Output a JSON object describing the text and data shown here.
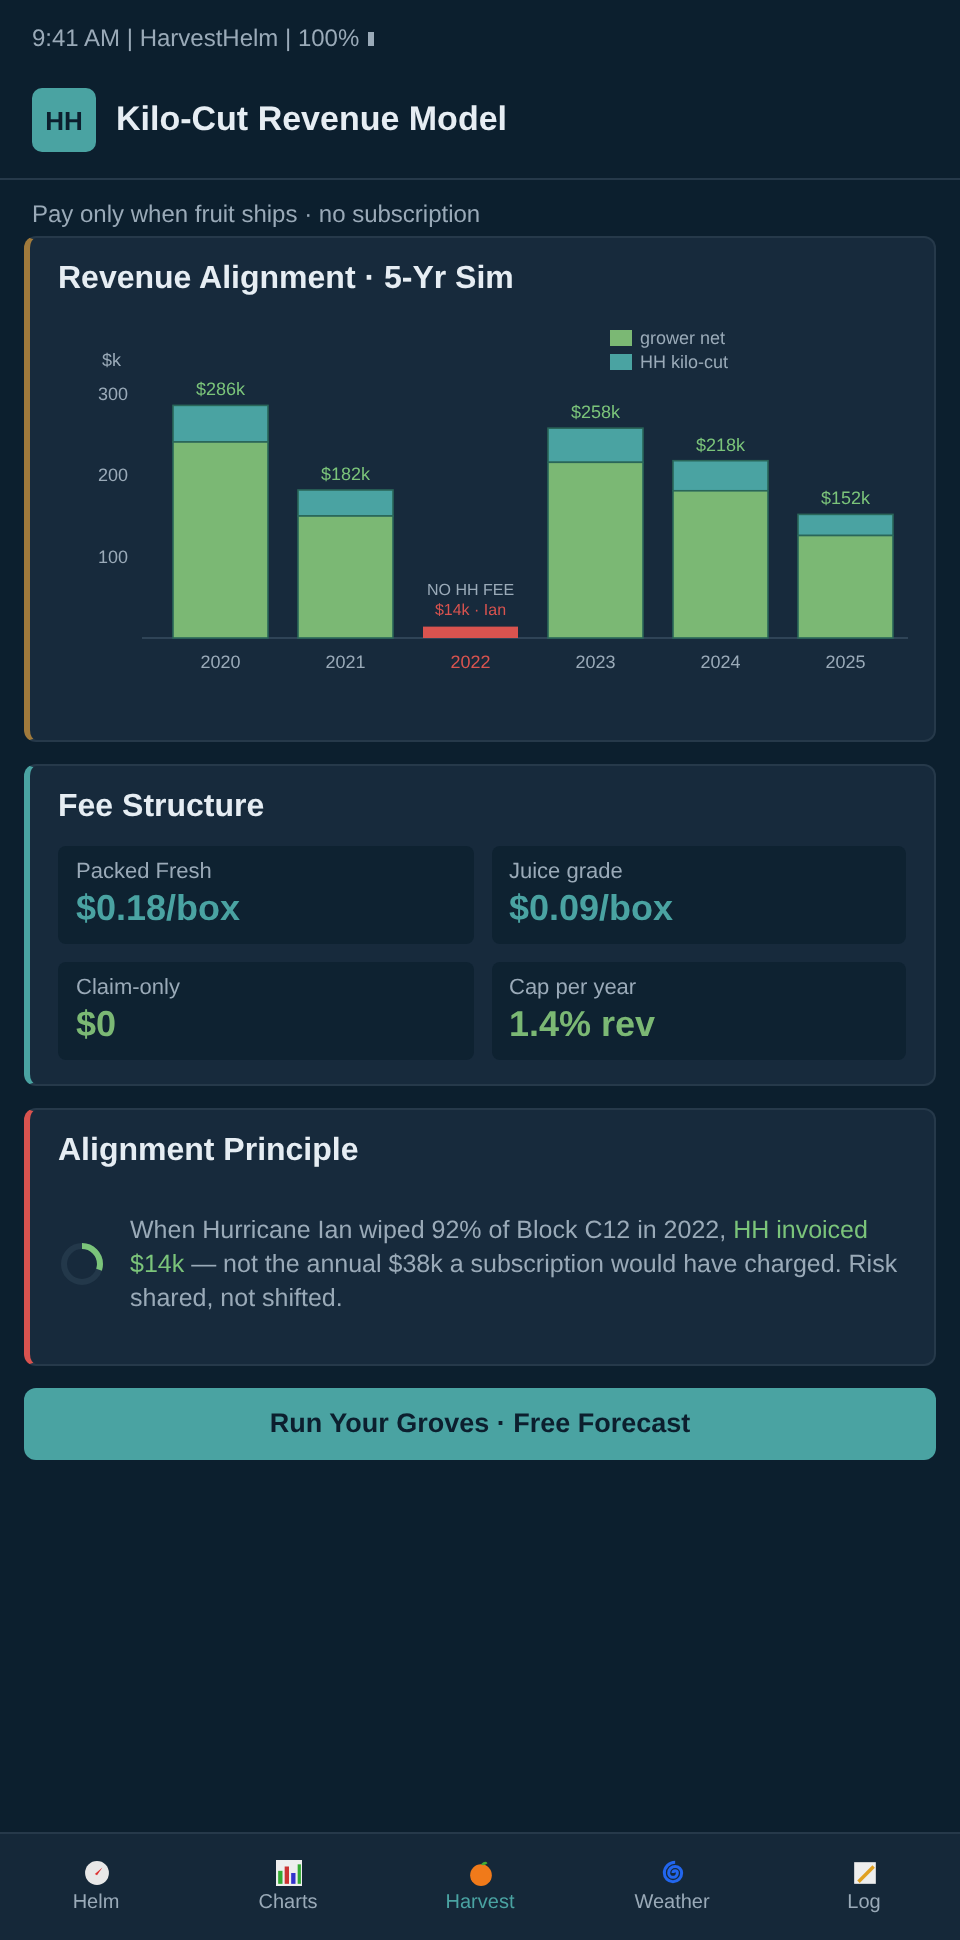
{
  "status_bar": {
    "text": "9:41 AM | HarvestHelm | 100%"
  },
  "header": {
    "logo": "HH",
    "title": "Kilo-Cut Revenue Model"
  },
  "subtitle": "Pay only when fruit ships · no subscription",
  "revenue_card": {
    "title": "Revenue Alignment · 5-Yr Sim",
    "color": "#a07a3c",
    "chart_data": {
      "type": "bar",
      "stacked": true,
      "ylabel": "$k",
      "ylim": [
        0,
        300
      ],
      "yticks": [
        100,
        200,
        300
      ],
      "categories": [
        "2020",
        "2021",
        "2022",
        "2023",
        "2024",
        "2025"
      ],
      "series": [
        {
          "name": "grower net",
          "color": "#7bb874",
          "values": [
            241,
            150,
            null,
            216,
            181,
            126
          ]
        },
        {
          "name": "HH kilo-cut",
          "color": "#4aa3a2",
          "values": [
            45,
            32,
            null,
            42,
            37,
            26
          ]
        },
        {
          "name": "$14k · Ian",
          "color": "#d9534f",
          "values": [
            null,
            null,
            14,
            null,
            null,
            null
          ]
        }
      ],
      "legend": "top-right",
      "value_labels": [
        "$286k",
        "$182k",
        null,
        "$258k",
        "$218k",
        "$152k"
      ],
      "annotations": [
        "NO HH FEE"
      ]
    }
  },
  "fee_card": {
    "title": "Fee Structure",
    "color": "#4aa3a2",
    "tiles": [
      {
        "label": "Packed Fresh",
        "value": "$0.18/box",
        "color": "#4aa3a2"
      },
      {
        "label": "Juice grade",
        "value": "$0.09/box",
        "color": "#4aa3a2"
      },
      {
        "label": "Claim-only",
        "value": "$0",
        "color": "#7bb874"
      },
      {
        "label": "Cap per year",
        "value": "1.4% rev",
        "color": "#7bb874"
      }
    ]
  },
  "principle_card": {
    "title": "Alignment Principle",
    "color": "#d9534f",
    "text": "When Hurricane Ian wiped 92% of Block C12 in 2022, **HH invoiced $14k** — not the annual $38k a subscription would have charged. Risk shared, not shifted."
  },
  "cta": "Run Your Groves · Free Forecast",
  "tabs": [
    {
      "label": "Helm",
      "kind": "compass",
      "selected": false
    },
    {
      "label": "Charts",
      "kind": "chart",
      "selected": false
    },
    {
      "label": "Harvest",
      "kind": "orange",
      "selected": true
    },
    {
      "label": "Weather",
      "kind": "spiral",
      "selected": false
    },
    {
      "label": "Log",
      "kind": "memo",
      "selected": false
    }
  ]
}
